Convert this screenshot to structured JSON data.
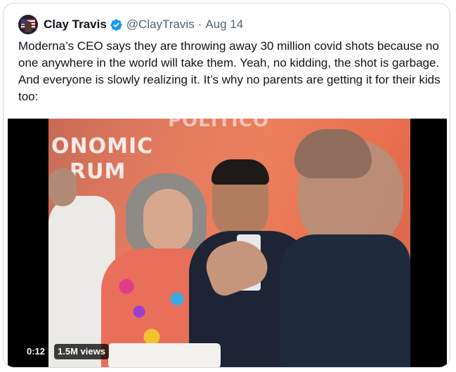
{
  "tweet": {
    "display_name": "Clay Travis",
    "handle": "@ClayTravis",
    "separator": "·",
    "date": "Aug 14",
    "verified": true,
    "text": "Moderna’s CEO says they are throwing away 30 million covid shots because no one anywhere in the world will take them. Yeah, no kidding, the shot is garbage. And everyone is slowly realizing it. It’s why no parents are getting it for their kids too:"
  },
  "media": {
    "type": "video",
    "elapsed": "0:12",
    "views": "1.5M views",
    "backdrop_text": [
      "ONOMIC",
      "RUM",
      "POLITICO"
    ]
  },
  "colors": {
    "name": "#0f1419",
    "secondary": "#536471",
    "verified": "#1d9bf0",
    "border": "#cfd9de",
    "backdrop": "#e07a5f"
  }
}
